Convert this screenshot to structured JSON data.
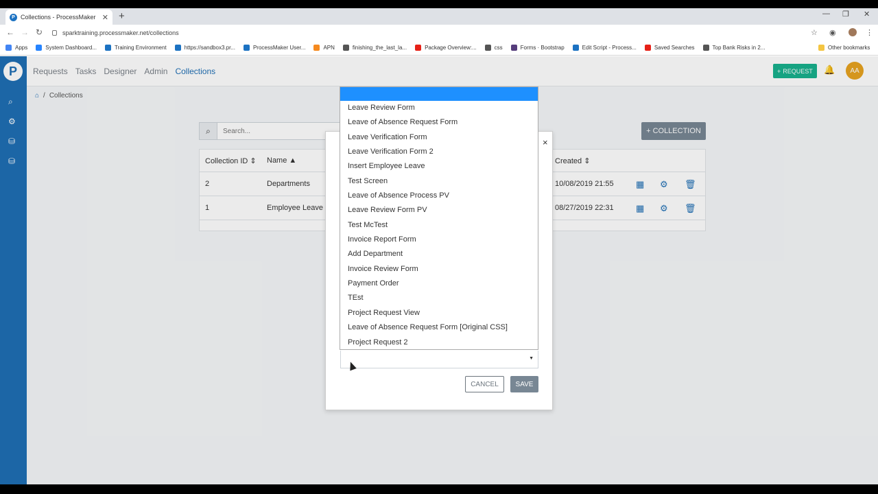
{
  "browser": {
    "tab_title": "Collections - ProcessMaker",
    "url": "sparktraining.processmaker.net/collections",
    "bookmarks": [
      {
        "label": "Apps",
        "color": "#4285f4"
      },
      {
        "label": "System Dashboard...",
        "color": "#2684ff"
      },
      {
        "label": "Training Environment",
        "color": "#1c72c2"
      },
      {
        "label": "https://sandbox3.pr...",
        "color": "#1c72c2"
      },
      {
        "label": "ProcessMaker User...",
        "color": "#1c72c2"
      },
      {
        "label": "APN",
        "color": "#f58a1f"
      },
      {
        "label": "finishing_the_last_la...",
        "color": "#555555"
      },
      {
        "label": "Package Overview:...",
        "color": "#e62117"
      },
      {
        "label": "css",
        "color": "#555555"
      },
      {
        "label": "Forms · Bootstrap",
        "color": "#563d7c"
      },
      {
        "label": "Edit Script - Process...",
        "color": "#1c72c2"
      },
      {
        "label": "Saved Searches",
        "color": "#e62117"
      },
      {
        "label": "Top Bank Risks in 2...",
        "color": "#555555"
      }
    ],
    "other_bookmarks": "Other bookmarks"
  },
  "nav": {
    "items": [
      "Requests",
      "Tasks",
      "Designer",
      "Admin",
      "Collections"
    ],
    "request_button": "REQUEST",
    "avatar_initials": "AA"
  },
  "breadcrumb": {
    "current": "Collections"
  },
  "search": {
    "placeholder": "Search..."
  },
  "collection_button": "COLLECTION",
  "table": {
    "headers": [
      "Collection ID",
      "Name",
      "Created"
    ],
    "rows": [
      {
        "id": "2",
        "name": "Departments",
        "created": "10/08/2019 21:55"
      },
      {
        "id": "1",
        "name": "Employee Leave",
        "created": "08/27/2019 22:31"
      }
    ]
  },
  "modal": {
    "cancel_label": "CANCEL",
    "save_label": "SAVE",
    "close_glyph": "×"
  },
  "dropdown": {
    "options": [
      "Leave Review Form",
      "Leave of Absence Request Form",
      "Leave Verification Form",
      "Leave Verification Form 2",
      "Insert Employee Leave",
      "Test Screen",
      "Leave of Absence Process PV",
      "Leave Review Form PV",
      "Test McTest",
      "Invoice Report Form",
      "Add Department",
      "Invoice Review Form",
      "Payment Order",
      "TEst",
      "Project Request View",
      "Leave of Absence Request Form [Original CSS]",
      "Project Request 2"
    ],
    "highlight_color": "#1e90ff"
  }
}
